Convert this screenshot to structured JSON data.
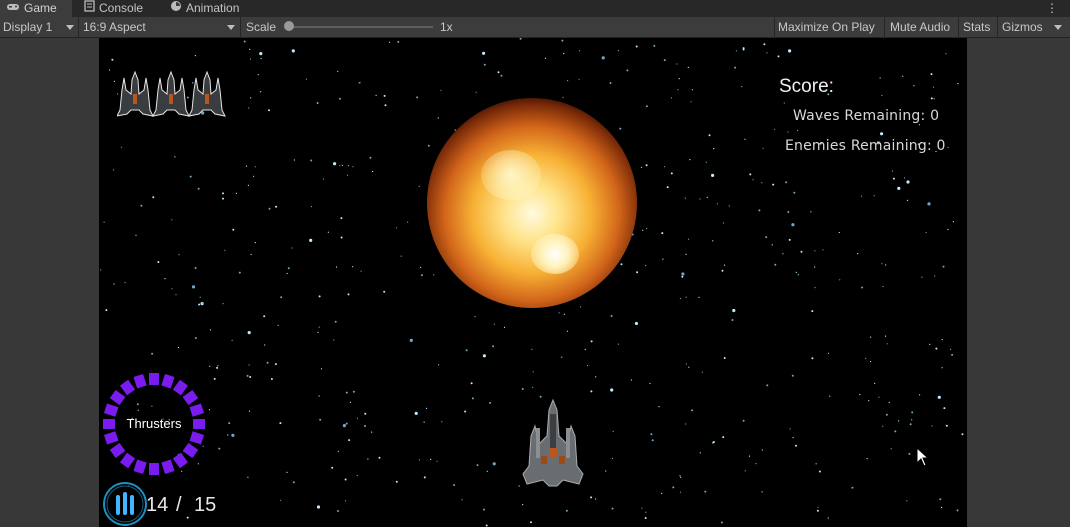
{
  "tabs": [
    {
      "label": "Game",
      "icon": "gamepad-icon",
      "active": true
    },
    {
      "label": "Console",
      "icon": "console-icon",
      "active": false
    },
    {
      "label": "Animation",
      "icon": "animation-icon",
      "active": false
    }
  ],
  "toolbar": {
    "display": "Display 1",
    "aspect": "16:9 Aspect",
    "scale_label": "Scale",
    "scale_value": "1x",
    "maximize_on_play": "Maximize On Play",
    "mute_audio": "Mute Audio",
    "stats": "Stats",
    "gizmos": "Gizmos"
  },
  "hud": {
    "score_label": "Score:",
    "waves_remaining": "Waves Remaining: 0",
    "enemies_remaining": "Enemies Remaining: 0",
    "thrusters_label": "Thrusters",
    "ammo_current": "14",
    "ammo_separator": "/",
    "ammo_max": "15",
    "lives": 3
  },
  "colors": {
    "thruster_ring": "#7a1cf0",
    "ammo_ring": "#1f8fc2",
    "ammo_bullets": "#3fb6ff"
  }
}
